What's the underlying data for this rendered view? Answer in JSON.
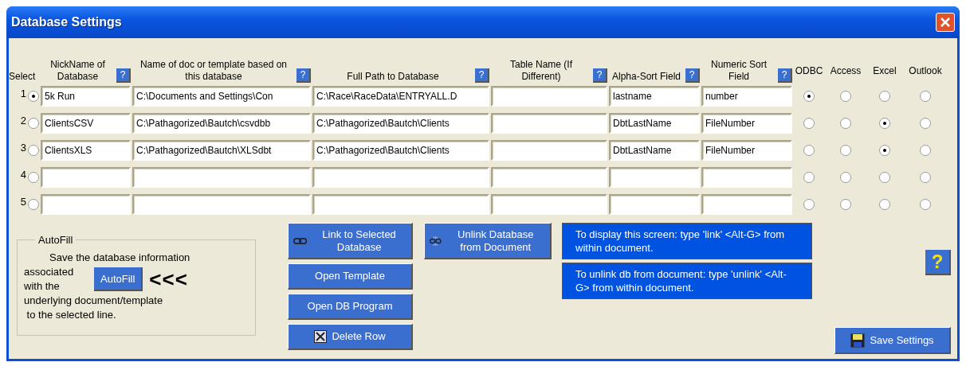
{
  "window": {
    "title": "Database Settings"
  },
  "columns": [
    {
      "label": "Select"
    },
    {
      "label": "NickName of Database",
      "help_button": "?"
    },
    {
      "label": "Name of doc or  template based on this database",
      "help_button": "?"
    },
    {
      "label": "Full Path to Database",
      "help_button": "?"
    },
    {
      "label": "Table Name (If Different)",
      "help_button": "?"
    },
    {
      "label": "Alpha-Sort Field",
      "help_button": "?"
    },
    {
      "label": "Numeric Sort Field",
      "help_button": "?"
    }
  ],
  "source_columns": [
    "ODBC",
    "Access",
    "Excel",
    "Outlook"
  ],
  "rows": [
    {
      "number": "1",
      "selected": true,
      "nickname": "5k Run",
      "document": "C:\\Documents and Settings\\Con",
      "path": "C:\\Race\\RaceData\\ENTRYALL.D",
      "alpha_sort": "lastname",
      "numeric_sort": "number",
      "sources": [
        {
          "selected": true
        },
        {
          "selected": false
        },
        {
          "selected": false
        },
        {
          "selected": false
        }
      ]
    },
    {
      "number": "2",
      "selected": false,
      "nickname": "ClientsCSV",
      "document": "C:\\Pathagorized\\Bautch\\csvdbb",
      "path": "C:\\Pathagorized\\Bautch\\Clients",
      "alpha_sort": "DbtLastName",
      "numeric_sort": "FileNumber",
      "sources": [
        {
          "selected": false
        },
        {
          "selected": false
        },
        {
          "selected": true
        },
        {
          "selected": false
        }
      ]
    },
    {
      "number": "3",
      "selected": false,
      "nickname": "ClientsXLS",
      "document": "C:\\Pathagorized\\Bautch\\XLSdbt",
      "path": "C:\\Pathagorized\\Bautch\\Clients",
      "alpha_sort": "DbtLastName",
      "numeric_sort": "FileNumber",
      "sources": [
        {
          "selected": false
        },
        {
          "selected": false
        },
        {
          "selected": true
        },
        {
          "selected": false
        }
      ]
    },
    {
      "number": "4",
      "selected": false,
      "sources": [
        {
          "selected": false
        },
        {
          "selected": false
        },
        {
          "selected": false
        },
        {
          "selected": false
        }
      ]
    },
    {
      "number": "5",
      "selected": false,
      "sources": [
        {
          "selected": false
        },
        {
          "selected": false
        },
        {
          "selected": false
        },
        {
          "selected": false
        }
      ]
    }
  ],
  "autofill": {
    "title": "AutoFill",
    "text_first": "Save the database information",
    "side_lines": [
      "associated",
      "with the"
    ],
    "text_lines": [
      "underlying document/template",
      " to the selected line."
    ],
    "button": "AutoFill",
    "arrows": "<<<"
  },
  "action_buttons": [
    {
      "label": "Link to Selected Database",
      "kind": "link"
    },
    {
      "label": "Open Template",
      "kind": "plain"
    },
    {
      "label": "Open DB Program",
      "kind": "plain"
    },
    {
      "label": "Delete Row",
      "kind": "delete"
    }
  ],
  "unlink_button": "Unlink Database from Document",
  "info_notes": [
    "To display this screen: type 'link' <Alt-G> from within document.",
    "To unlink db from document:  type 'unlink' <Alt-G>  from within document."
  ],
  "help_button": "?",
  "save_button": "Save Settings"
}
